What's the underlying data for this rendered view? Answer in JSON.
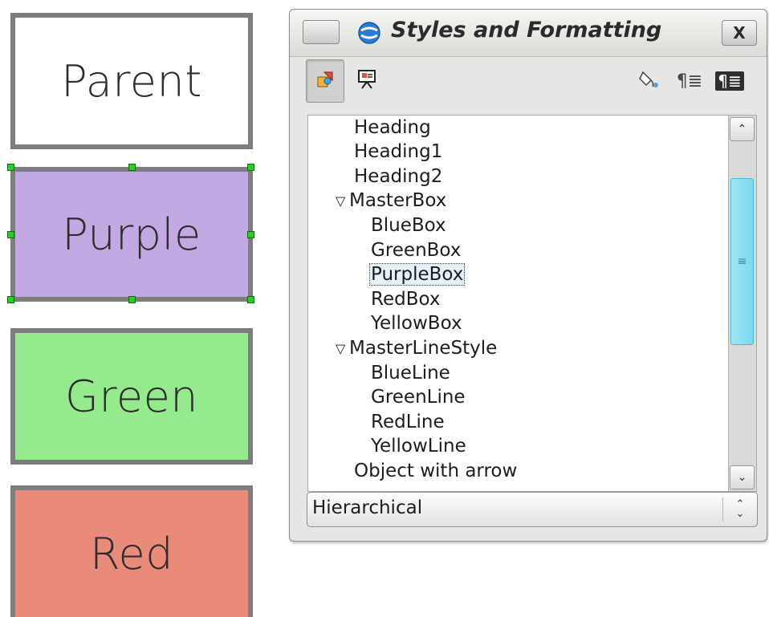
{
  "canvas": {
    "shapes": [
      {
        "label": "Parent",
        "fill": "#ffffff",
        "selected": false
      },
      {
        "label": "Purple",
        "fill": "#c3a9e3",
        "selected": true
      },
      {
        "label": "Green",
        "fill": "#96ea8e",
        "selected": false
      },
      {
        "label": "Red",
        "fill": "#ea8a7a",
        "selected": false
      }
    ]
  },
  "panel": {
    "title": "Styles and Formatting",
    "close_glyph": "X",
    "toolbar": {
      "left": [
        {
          "icon": "graphics-styles-icon",
          "pressed": true
        },
        {
          "icon": "presentation-styles-icon",
          "pressed": false
        }
      ],
      "right": [
        {
          "icon": "fill-format-mode-icon",
          "pressed": false
        },
        {
          "icon": "new-style-from-selection-icon",
          "glyph": "¶≣",
          "pressed": false
        },
        {
          "icon": "update-style-icon",
          "glyph": "¶≣",
          "pressed": false
        }
      ]
    },
    "styles_tree": [
      {
        "label": "Heading",
        "level": 1,
        "expandable": false
      },
      {
        "label": "Heading1",
        "level": 1,
        "expandable": false
      },
      {
        "label": "Heading2",
        "level": 1,
        "expandable": false
      },
      {
        "label": "MasterBox",
        "level": 0,
        "expandable": true,
        "expanded": true,
        "expander_glyph": "▽"
      },
      {
        "label": "BlueBox",
        "level": 2,
        "expandable": false
      },
      {
        "label": "GreenBox",
        "level": 2,
        "expandable": false
      },
      {
        "label": "PurpleBox",
        "level": 2,
        "expandable": false,
        "selected": true
      },
      {
        "label": "RedBox",
        "level": 2,
        "expandable": false
      },
      {
        "label": "YellowBox",
        "level": 2,
        "expandable": false
      },
      {
        "label": "MasterLineStyle",
        "level": 0,
        "expandable": true,
        "expanded": true,
        "expander_glyph": "▽"
      },
      {
        "label": "BlueLine",
        "level": 2,
        "expandable": false
      },
      {
        "label": "GreenLine",
        "level": 2,
        "expandable": false
      },
      {
        "label": "RedLine",
        "level": 2,
        "expandable": false
      },
      {
        "label": "YellowLine",
        "level": 2,
        "expandable": false
      },
      {
        "label": "Object with arrow",
        "level": 1,
        "expandable": false
      }
    ],
    "scrollbar": {
      "up_glyph": "⌃",
      "down_glyph": "⌄",
      "grip_glyph": "≡"
    },
    "filter": {
      "value": "Hierarchical",
      "arrow_up": "⌃",
      "arrow_down": "⌄"
    }
  }
}
